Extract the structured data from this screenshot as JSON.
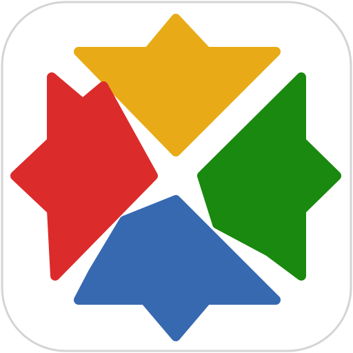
{
  "icon": {
    "name": "four-arrow-star-app-icon",
    "colors": {
      "background": "#ffffff",
      "border": "#d4d4d4",
      "top": "#e8ab17",
      "left": "#dc2b2b",
      "right": "#19890f",
      "bottom": "#3769b0"
    }
  }
}
